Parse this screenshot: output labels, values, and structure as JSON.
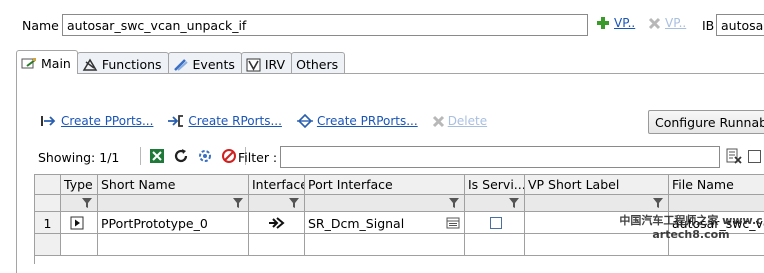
{
  "header": {
    "name_label": "Name",
    "name_value": "autosar_swc_vcan_unpack_if",
    "vp_add_label": "VP..",
    "vp_remove_label": "VP..",
    "ib_label": "IB",
    "ib_value": "autosar"
  },
  "tabs": [
    {
      "label": "Main",
      "icon": "main-tab-icon",
      "active": true
    },
    {
      "label": "Functions",
      "icon": "functions-icon",
      "active": false
    },
    {
      "label": "Events",
      "icon": "events-icon",
      "active": false
    },
    {
      "label": "IRV",
      "icon": "irv-icon",
      "active": false
    },
    {
      "label": "Others",
      "icon": "",
      "active": false
    }
  ],
  "actions": {
    "create_pports": "Create PPorts...",
    "create_rports": "Create RPorts...",
    "create_prports": "Create PRPorts...",
    "delete": "Delete",
    "configure_runnables": "Configure Runnables"
  },
  "toolbar": {
    "showing": "Showing: 1/1",
    "filter_label": "Filter :",
    "filter_value": ""
  },
  "table": {
    "columns": [
      "",
      "Type",
      "Short Name",
      "Interface",
      "Port Interface",
      "Is Servi...",
      "VP Short Label",
      "File Name"
    ],
    "rows": [
      {
        "index": "1",
        "type_icon": "pport-icon",
        "short_name": "PPortPrototype_0",
        "interface_icon": "sender-receiver-icon",
        "port_interface": "SR_Dcm_Signal",
        "is_service": false,
        "vp_short_label": "",
        "file_name": "autosar_swc_vca"
      }
    ]
  },
  "colors": {
    "link": "#1a55b8",
    "link_disabled": "#a9bfe0",
    "add_green": "#3a9a2a",
    "grid_border": "#a0a0a0"
  },
  "watermark": "中国汽车工程师之家 www.cartech8.com"
}
